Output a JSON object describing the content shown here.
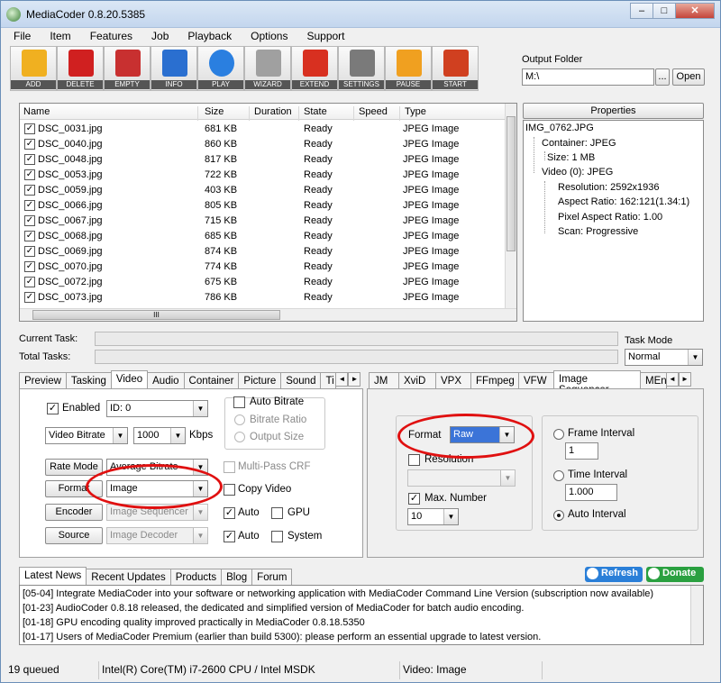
{
  "window": {
    "title": "MediaCoder 0.8.20.5385",
    "buttons": [
      "–",
      "□",
      "✕"
    ]
  },
  "menu": [
    "File",
    "Item",
    "Features",
    "Job",
    "Playback",
    "Options",
    "Support"
  ],
  "toolbar": [
    {
      "label": "ADD",
      "icon": "add-icon",
      "color": "#f0b020"
    },
    {
      "label": "DELETE",
      "icon": "delete-icon",
      "color": "#d02020"
    },
    {
      "label": "EMPTY",
      "icon": "empty-icon",
      "color": "#c83030"
    },
    {
      "label": "INFO",
      "icon": "info-icon",
      "color": "#2a6fd0"
    },
    {
      "label": "PLAY",
      "icon": "play-icon",
      "color": "#2a7fe0"
    },
    {
      "label": "WIZARD",
      "icon": "wizard-icon",
      "color": "#a0a0a0"
    },
    {
      "label": "EXTEND",
      "icon": "extend-icon",
      "color": "#d83020"
    },
    {
      "label": "SETTINGS",
      "icon": "settings-icon",
      "color": "#7a7a7a"
    },
    {
      "label": "PAUSE",
      "icon": "pause-icon",
      "color": "#f0a020"
    },
    {
      "label": "START",
      "icon": "start-icon",
      "color": "#d04020"
    }
  ],
  "output": {
    "label": "Output Folder",
    "value": "M:\\",
    "browse": "...",
    "open": "Open"
  },
  "filelist": {
    "columns": [
      "Name",
      "Size",
      "Duration",
      "State",
      "Speed",
      "Type"
    ],
    "rows": [
      {
        "name": "DSC_0031.jpg",
        "size": "681 KB",
        "state": "Ready",
        "type": "JPEG Image"
      },
      {
        "name": "DSC_0040.jpg",
        "size": "860 KB",
        "state": "Ready",
        "type": "JPEG Image"
      },
      {
        "name": "DSC_0048.jpg",
        "size": "817 KB",
        "state": "Ready",
        "type": "JPEG Image"
      },
      {
        "name": "DSC_0053.jpg",
        "size": "722 KB",
        "state": "Ready",
        "type": "JPEG Image"
      },
      {
        "name": "DSC_0059.jpg",
        "size": "403 KB",
        "state": "Ready",
        "type": "JPEG Image"
      },
      {
        "name": "DSC_0066.jpg",
        "size": "805 KB",
        "state": "Ready",
        "type": "JPEG Image"
      },
      {
        "name": "DSC_0067.jpg",
        "size": "715 KB",
        "state": "Ready",
        "type": "JPEG Image"
      },
      {
        "name": "DSC_0068.jpg",
        "size": "685 KB",
        "state": "Ready",
        "type": "JPEG Image"
      },
      {
        "name": "DSC_0069.jpg",
        "size": "874 KB",
        "state": "Ready",
        "type": "JPEG Image"
      },
      {
        "name": "DSC_0070.jpg",
        "size": "774 KB",
        "state": "Ready",
        "type": "JPEG Image"
      },
      {
        "name": "DSC_0072.jpg",
        "size": "675 KB",
        "state": "Ready",
        "type": "JPEG Image"
      },
      {
        "name": "DSC_0073.jpg",
        "size": "786 KB",
        "state": "Ready",
        "type": "JPEG Image"
      }
    ]
  },
  "properties": {
    "title": "Properties",
    "items": [
      {
        "text": "IMG_0762.JPG",
        "level": 0
      },
      {
        "text": "Container: JPEG",
        "level": 1
      },
      {
        "text": "Size: 1 MB",
        "level": 2
      },
      {
        "text": "Video (0): JPEG",
        "level": 1
      },
      {
        "text": "Resolution: 2592x1936",
        "level": 2
      },
      {
        "text": "Aspect Ratio: 162:121(1.34:1)",
        "level": 2
      },
      {
        "text": "Pixel Aspect Ratio: 1.00",
        "level": 2
      },
      {
        "text": "Scan: Progressive",
        "level": 2
      }
    ]
  },
  "tasks": {
    "current": "Current Task:",
    "total": "Total Tasks:",
    "mode_label": "Task Mode",
    "mode_value": "Normal"
  },
  "left_tabs": [
    "Preview",
    "Tasking",
    "Video",
    "Audio",
    "Container",
    "Picture",
    "Sound",
    "Ti"
  ],
  "right_tabs": [
    "JM",
    "XviD",
    "VPX",
    "FFmpeg",
    "VFW",
    "Image Sequencer",
    "MEnc"
  ],
  "video": {
    "enabled": "Enabled",
    "id_value": "ID: 0",
    "bitrate_mode": "Video Bitrate",
    "bitrate_value": "1000",
    "kbps": "Kbps",
    "auto_bitrate": "Auto Bitrate",
    "bitrate_ratio": "Bitrate Ratio",
    "output_size": "Output Size",
    "rate_mode_btn": "Rate Mode",
    "rate_mode_value": "Average Bitrate",
    "multipass": "Multi-Pass CRF",
    "format_btn": "Format",
    "format_value": "Image",
    "copy_video": "Copy Video",
    "encoder_btn": "Encoder",
    "encoder_value": "Image Sequencer",
    "auto": "Auto",
    "gpu": "GPU",
    "source_btn": "Source",
    "source_value": "Image Decoder",
    "system": "System"
  },
  "imgseq": {
    "format_label": "Format",
    "format_value": "Raw",
    "resolution": "Resolution",
    "max_number": "Max. Number",
    "max_value": "10",
    "frame_interval": "Frame Interval",
    "frame_value": "1",
    "time_interval": "Time Interval",
    "time_value": "1.000",
    "auto_interval": "Auto Interval"
  },
  "news": {
    "tabs": [
      "Latest News",
      "Recent Updates",
      "Products",
      "Blog",
      "Forum"
    ],
    "refresh": "Refresh",
    "donate": "Donate",
    "items": [
      "[05-04] Integrate MediaCoder into your software or networking application with MediaCoder Command Line Version (subscription now available)",
      "[01-23] AudioCoder 0.8.18 released, the dedicated and simplified version of MediaCoder for batch audio encoding.",
      "[01-18] GPU encoding quality improved practically in MediaCoder 0.8.18.5350",
      "[01-17] Users of MediaCoder Premium (earlier than build 5300): please perform an essential upgrade to latest version."
    ]
  },
  "status": {
    "queued": "19 queued",
    "cpu": "Intel(R) Core(TM) i7-2600 CPU  / Intel MSDK",
    "video": "Video: Image"
  },
  "colors": {
    "annotation": "#e01010",
    "refresh": "#2a7fd8",
    "donate": "#2aa040"
  }
}
